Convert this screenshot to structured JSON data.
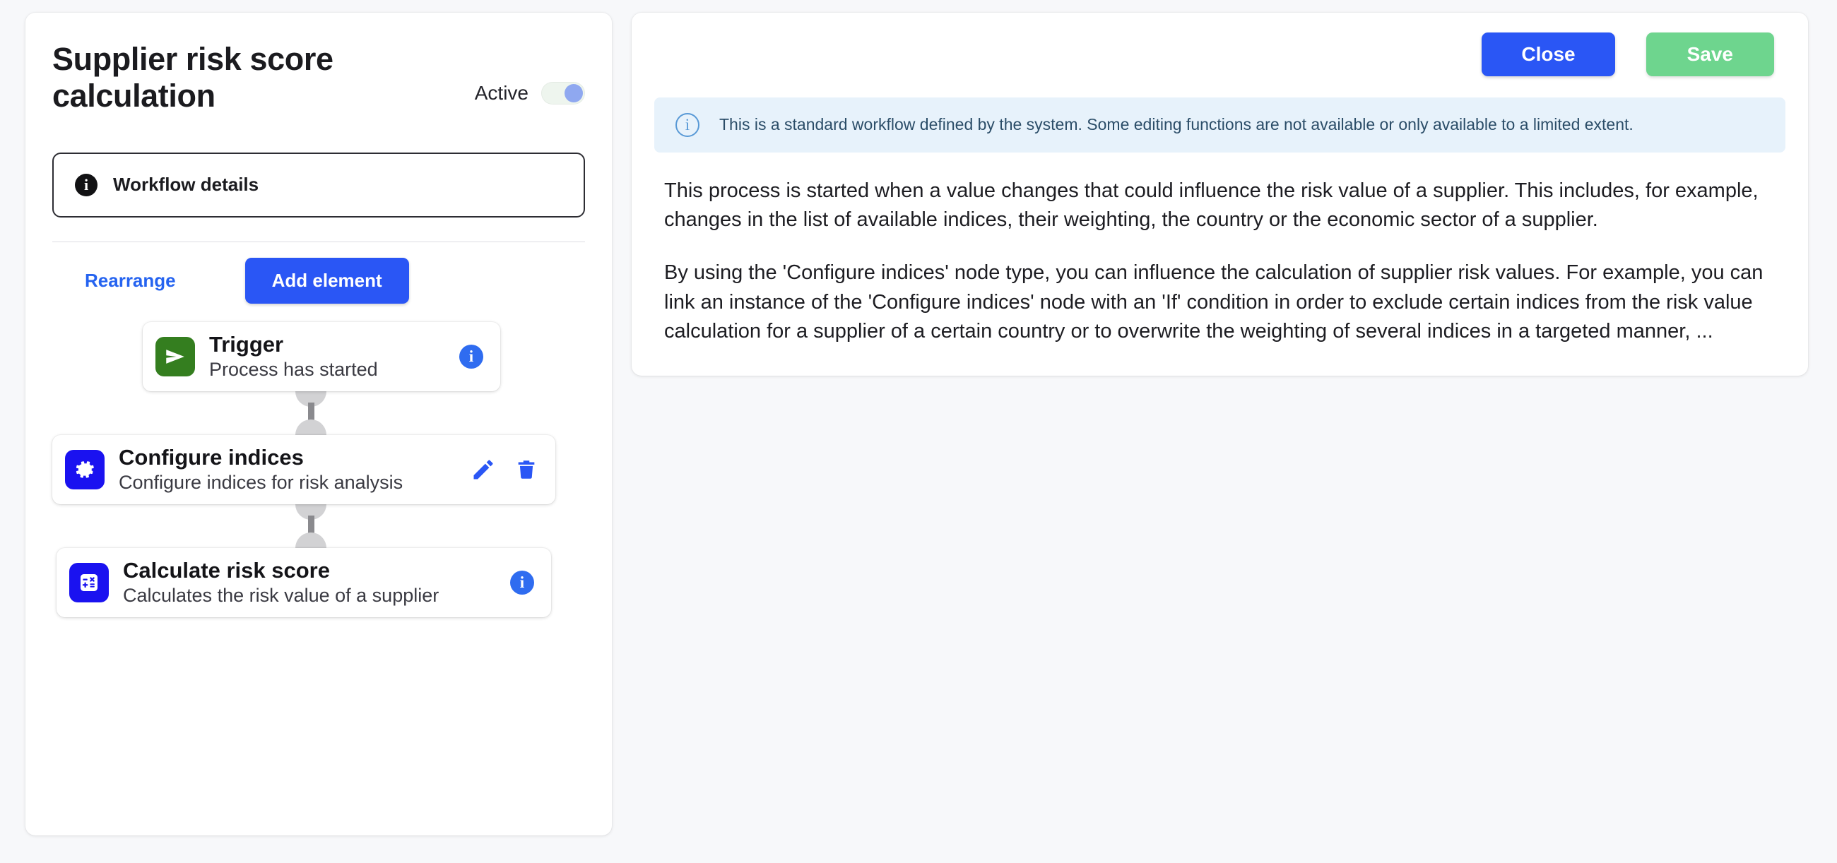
{
  "workflow": {
    "title": "Supplier risk score calculation",
    "status_label": "Active",
    "status_on": true,
    "details_label": "Workflow details",
    "details_icon": "info-icon",
    "rearrange_label": "Rearrange",
    "add_element_label": "Add element",
    "nodes": [
      {
        "title": "Trigger",
        "subtitle": "Process has started",
        "icon": "send-arrow-icon",
        "icon_color": "#347e1f",
        "actions": [
          "info-badge"
        ]
      },
      {
        "title": "Configure indices",
        "subtitle": "Configure indices for risk analysis",
        "icon": "gear-icon",
        "icon_color": "#1a12f0",
        "actions": [
          "edit-pencil-icon",
          "delete-trash-icon"
        ]
      },
      {
        "title": "Calculate risk score",
        "subtitle": "Calculates the risk value of a supplier",
        "icon": "calculator-icon",
        "icon_color": "#1a12f0",
        "actions": [
          "info-badge"
        ]
      }
    ]
  },
  "detail_panel": {
    "close_label": "Close",
    "save_label": "Save",
    "banner": {
      "icon": "info-circle-icon",
      "text": "This is a standard workflow defined by the system. Some editing functions are not available or only available to a limited extent."
    },
    "paragraphs": [
      "This process is started when a value changes that could influence the risk value of a supplier. This includes, for example, changes in the list of available indices, their weighting, the country or the economic sector of a supplier.",
      "By using the 'Configure indices' node type, you can influence the calculation of supplier risk values. For example, you can link an instance of the 'Configure indices' node with an 'If' condition in order to exclude certain indices from the risk value calculation for a supplier of a certain country or to overwrite the weighting of several indices in a targeted manner, ..."
    ]
  },
  "colors": {
    "primary_blue": "#2a56f5",
    "link_blue": "#2563f0",
    "save_green": "#6ed58e",
    "trigger_green": "#347e1f",
    "node_blue": "#1a12f0",
    "banner_bg": "#e7f2fb",
    "toggle_knob": "#8fa8f0"
  },
  "icon_glyphs": {
    "info": "i"
  }
}
